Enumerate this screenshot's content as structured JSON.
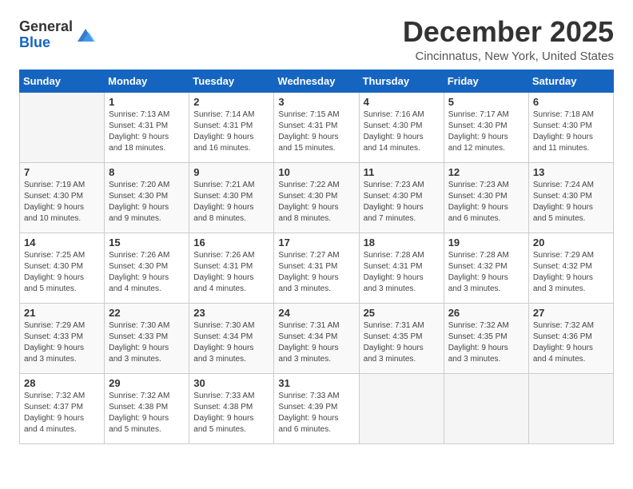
{
  "logo": {
    "general": "General",
    "blue": "Blue"
  },
  "title": "December 2025",
  "location": "Cincinnatus, New York, United States",
  "weekdays": [
    "Sunday",
    "Monday",
    "Tuesday",
    "Wednesday",
    "Thursday",
    "Friday",
    "Saturday"
  ],
  "weeks": [
    [
      {
        "day": "",
        "info": ""
      },
      {
        "day": "1",
        "info": "Sunrise: 7:13 AM\nSunset: 4:31 PM\nDaylight: 9 hours\nand 18 minutes."
      },
      {
        "day": "2",
        "info": "Sunrise: 7:14 AM\nSunset: 4:31 PM\nDaylight: 9 hours\nand 16 minutes."
      },
      {
        "day": "3",
        "info": "Sunrise: 7:15 AM\nSunset: 4:31 PM\nDaylight: 9 hours\nand 15 minutes."
      },
      {
        "day": "4",
        "info": "Sunrise: 7:16 AM\nSunset: 4:30 PM\nDaylight: 9 hours\nand 14 minutes."
      },
      {
        "day": "5",
        "info": "Sunrise: 7:17 AM\nSunset: 4:30 PM\nDaylight: 9 hours\nand 12 minutes."
      },
      {
        "day": "6",
        "info": "Sunrise: 7:18 AM\nSunset: 4:30 PM\nDaylight: 9 hours\nand 11 minutes."
      }
    ],
    [
      {
        "day": "7",
        "info": "Sunrise: 7:19 AM\nSunset: 4:30 PM\nDaylight: 9 hours\nand 10 minutes."
      },
      {
        "day": "8",
        "info": "Sunrise: 7:20 AM\nSunset: 4:30 PM\nDaylight: 9 hours\nand 9 minutes."
      },
      {
        "day": "9",
        "info": "Sunrise: 7:21 AM\nSunset: 4:30 PM\nDaylight: 9 hours\nand 8 minutes."
      },
      {
        "day": "10",
        "info": "Sunrise: 7:22 AM\nSunset: 4:30 PM\nDaylight: 9 hours\nand 8 minutes."
      },
      {
        "day": "11",
        "info": "Sunrise: 7:23 AM\nSunset: 4:30 PM\nDaylight: 9 hours\nand 7 minutes."
      },
      {
        "day": "12",
        "info": "Sunrise: 7:23 AM\nSunset: 4:30 PM\nDaylight: 9 hours\nand 6 minutes."
      },
      {
        "day": "13",
        "info": "Sunrise: 7:24 AM\nSunset: 4:30 PM\nDaylight: 9 hours\nand 5 minutes."
      }
    ],
    [
      {
        "day": "14",
        "info": "Sunrise: 7:25 AM\nSunset: 4:30 PM\nDaylight: 9 hours\nand 5 minutes."
      },
      {
        "day": "15",
        "info": "Sunrise: 7:26 AM\nSunset: 4:30 PM\nDaylight: 9 hours\nand 4 minutes."
      },
      {
        "day": "16",
        "info": "Sunrise: 7:26 AM\nSunset: 4:31 PM\nDaylight: 9 hours\nand 4 minutes."
      },
      {
        "day": "17",
        "info": "Sunrise: 7:27 AM\nSunset: 4:31 PM\nDaylight: 9 hours\nand 3 minutes."
      },
      {
        "day": "18",
        "info": "Sunrise: 7:28 AM\nSunset: 4:31 PM\nDaylight: 9 hours\nand 3 minutes."
      },
      {
        "day": "19",
        "info": "Sunrise: 7:28 AM\nSunset: 4:32 PM\nDaylight: 9 hours\nand 3 minutes."
      },
      {
        "day": "20",
        "info": "Sunrise: 7:29 AM\nSunset: 4:32 PM\nDaylight: 9 hours\nand 3 minutes."
      }
    ],
    [
      {
        "day": "21",
        "info": "Sunrise: 7:29 AM\nSunset: 4:33 PM\nDaylight: 9 hours\nand 3 minutes."
      },
      {
        "day": "22",
        "info": "Sunrise: 7:30 AM\nSunset: 4:33 PM\nDaylight: 9 hours\nand 3 minutes."
      },
      {
        "day": "23",
        "info": "Sunrise: 7:30 AM\nSunset: 4:34 PM\nDaylight: 9 hours\nand 3 minutes."
      },
      {
        "day": "24",
        "info": "Sunrise: 7:31 AM\nSunset: 4:34 PM\nDaylight: 9 hours\nand 3 minutes."
      },
      {
        "day": "25",
        "info": "Sunrise: 7:31 AM\nSunset: 4:35 PM\nDaylight: 9 hours\nand 3 minutes."
      },
      {
        "day": "26",
        "info": "Sunrise: 7:32 AM\nSunset: 4:35 PM\nDaylight: 9 hours\nand 3 minutes."
      },
      {
        "day": "27",
        "info": "Sunrise: 7:32 AM\nSunset: 4:36 PM\nDaylight: 9 hours\nand 4 minutes."
      }
    ],
    [
      {
        "day": "28",
        "info": "Sunrise: 7:32 AM\nSunset: 4:37 PM\nDaylight: 9 hours\nand 4 minutes."
      },
      {
        "day": "29",
        "info": "Sunrise: 7:32 AM\nSunset: 4:38 PM\nDaylight: 9 hours\nand 5 minutes."
      },
      {
        "day": "30",
        "info": "Sunrise: 7:33 AM\nSunset: 4:38 PM\nDaylight: 9 hours\nand 5 minutes."
      },
      {
        "day": "31",
        "info": "Sunrise: 7:33 AM\nSunset: 4:39 PM\nDaylight: 9 hours\nand 6 minutes."
      },
      {
        "day": "",
        "info": ""
      },
      {
        "day": "",
        "info": ""
      },
      {
        "day": "",
        "info": ""
      }
    ]
  ]
}
